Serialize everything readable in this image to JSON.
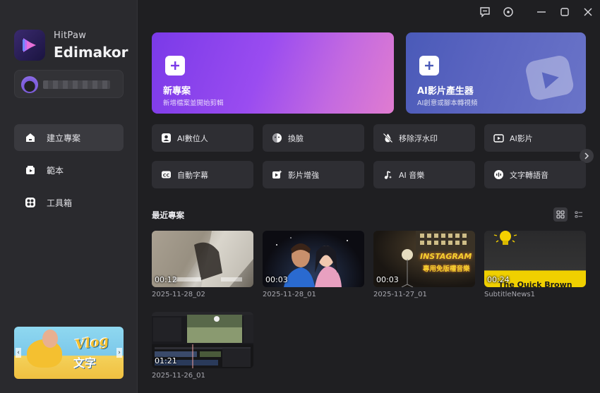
{
  "brand": {
    "small": "HitPaw",
    "big": "Edimakor"
  },
  "nav": [
    {
      "label": "建立專案",
      "icon": "home-icon"
    },
    {
      "label": "範本",
      "icon": "template-icon"
    },
    {
      "label": "工具箱",
      "icon": "toolbox-icon"
    }
  ],
  "banner": {
    "title": "Vlog",
    "subtitle": "文字"
  },
  "hero": [
    {
      "title": "新專案",
      "subtitle": "新增檔案並開始剪輯"
    },
    {
      "title": "AI影片產生器",
      "subtitle": "AI創意或腳本轉視頻"
    }
  ],
  "tools": [
    {
      "label": "AI數位人",
      "icon": "avatar-icon"
    },
    {
      "label": "換臉",
      "icon": "face-swap-icon"
    },
    {
      "label": "移除浮水印",
      "icon": "remove-watermark-icon"
    },
    {
      "label": "AI影片",
      "icon": "ai-video-icon"
    },
    {
      "label": "自動字幕",
      "icon": "subtitle-icon"
    },
    {
      "label": "影片增強",
      "icon": "enhance-icon"
    },
    {
      "label": "AI 音樂",
      "icon": "music-icon"
    },
    {
      "label": "文字轉語音",
      "icon": "tts-icon"
    }
  ],
  "recent": {
    "title": "最近專案",
    "projects": [
      {
        "name": "2025-11-28_02",
        "duration": "00:12"
      },
      {
        "name": "2025-11-28_01",
        "duration": "00:03"
      },
      {
        "name": "2025-11-27_01",
        "duration": "00:03"
      },
      {
        "name": "SubtitleNews1",
        "duration": "00:24"
      },
      {
        "name": "2025-11-26_01",
        "duration": "01:21"
      }
    ]
  },
  "thumb_text": {
    "instagram": "INSTAGRAM",
    "instagram_sub": "專用免版權音樂",
    "quick_brown": "The Quick Brown"
  },
  "colors": {
    "background": "#1f1f22",
    "sidebar": "#2a2a2e",
    "accent": "#7a3ae8",
    "tile": "#2e2e33"
  }
}
